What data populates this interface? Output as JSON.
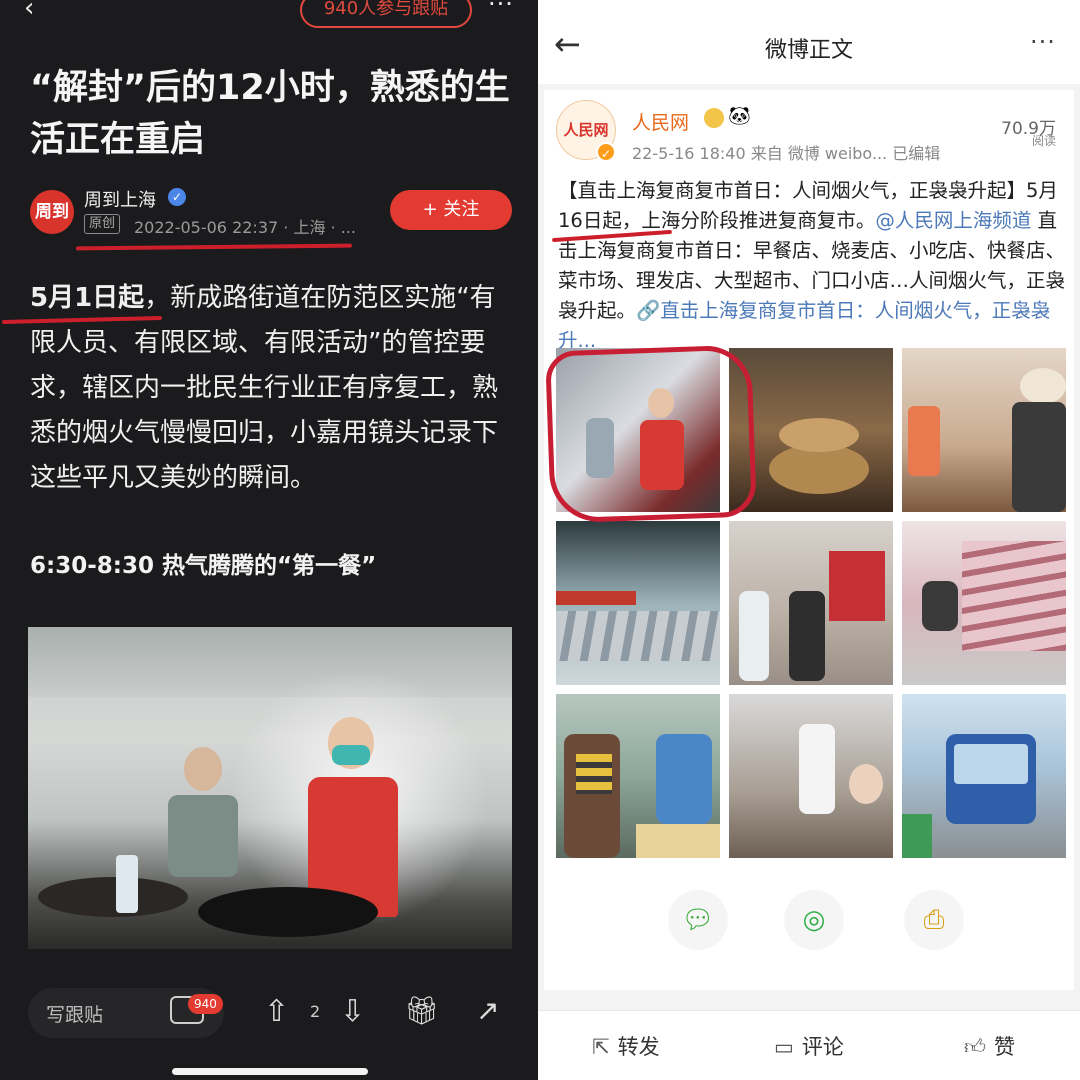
{
  "left": {
    "top_pill": "940人参与跟贴",
    "title": "“解封”后的12小时，熟悉的生活正在重启",
    "author": {
      "avatar_text": "周到",
      "name": "周到上海",
      "original_tag": "原创",
      "meta": "2022-05-06 22:37 · 上海 · ..."
    },
    "follow_label": "+ 关注",
    "body_highlight": "5月1日起",
    "body_rest": "，新成路街道在防范区实施“有限人员、有限区域、有限活动”的管控要求，辖区内一批民生行业正有序复工，熟悉的烟火气慢慢回归，小嘉用镜头记录下这些平凡又美妙的瞬间。",
    "section_title": "6:30-8:30 热气腾腾的“第一餐”",
    "bottom": {
      "write_label": "写跟贴",
      "comment_count": "940",
      "up_count": "2"
    },
    "icons": {
      "back": "back-arrow-icon",
      "more": "more-dots-icon",
      "comment": "comment-bubble-icon",
      "up": "arrow-up-icon",
      "down": "arrow-down-icon",
      "gift": "gift-icon",
      "share": "share-icon"
    }
  },
  "right": {
    "header_title": "微博正文",
    "account": {
      "name": "人民网",
      "avatar_text": "人民网",
      "meta": "22-5-16 18:40  来自 微博 weibo...  已编辑",
      "reads_value": "70.9万",
      "reads_label": "阅读"
    },
    "post": {
      "headline": "【直击上海复商复市首日：人间烟火气，正袅袅升起】",
      "date_highlight": "5月16日起",
      "line2": "，上海分阶段推进复商复市。",
      "mention": "@人民网上海频道",
      "body": " 直击上海复商复市首日：早餐店、烧麦店、小吃店、快餐店、菜市场、理发店、大型超市、门口小店…人间烟火气，正袅袅升起。",
      "link_text": "🔗直击上海复商复市首日：人间烟火气，正袅袅升..."
    },
    "footer": {
      "repost": "转发",
      "comment": "评论",
      "like": "赞"
    },
    "icons": {
      "wechat": "wechat-share-icon",
      "moments": "moments-share-icon",
      "save": "save-image-icon"
    }
  }
}
